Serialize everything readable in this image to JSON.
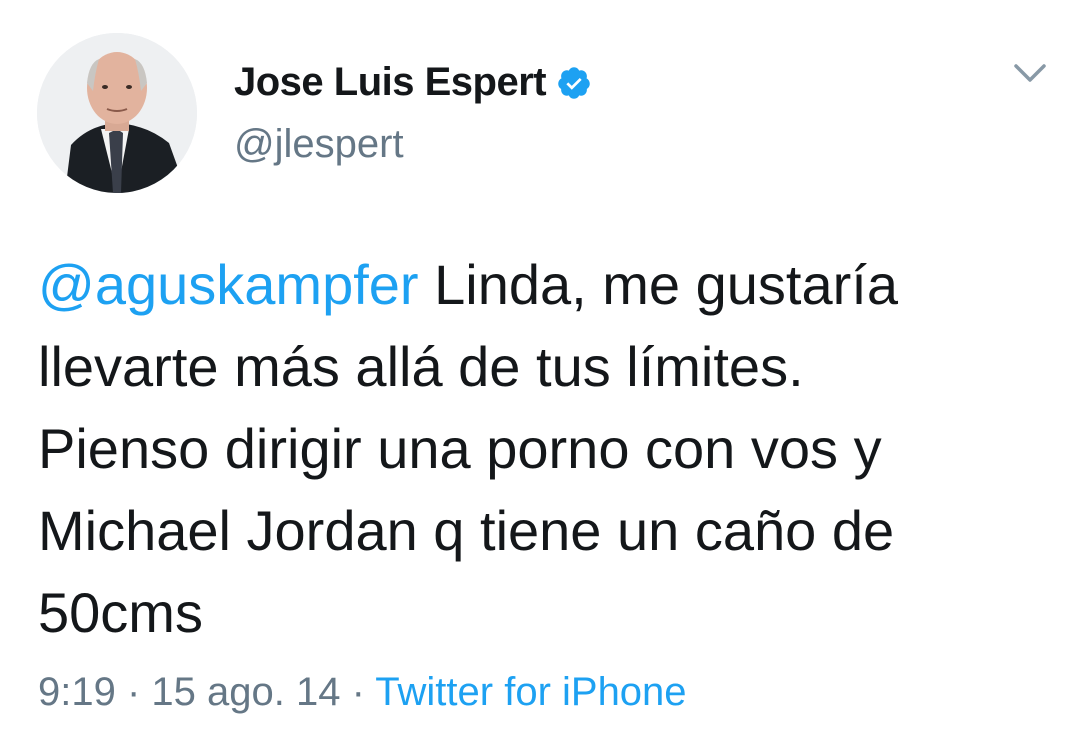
{
  "author": {
    "display_name": "Jose Luis Espert",
    "handle": "@jlespert",
    "verified_icon": "verified-badge-icon",
    "avatar_icon": "profile-photo"
  },
  "menu": {
    "icon": "chevron-down-icon"
  },
  "tweet": {
    "mention": "@aguskampfer",
    "body": " Linda, me gustaría\nllevarte más allá de tus límites.\nPienso dirigir una porno con vos y\nMichael Jordan q tiene un caño de\n50cms"
  },
  "meta": {
    "time": "9:19",
    "separator_1": " · ",
    "date": "15 ago. 14",
    "separator_2": " · ",
    "source": "Twitter for iPhone"
  },
  "colors": {
    "link": "#1da1f2",
    "text": "#14171a",
    "muted": "#657786"
  }
}
